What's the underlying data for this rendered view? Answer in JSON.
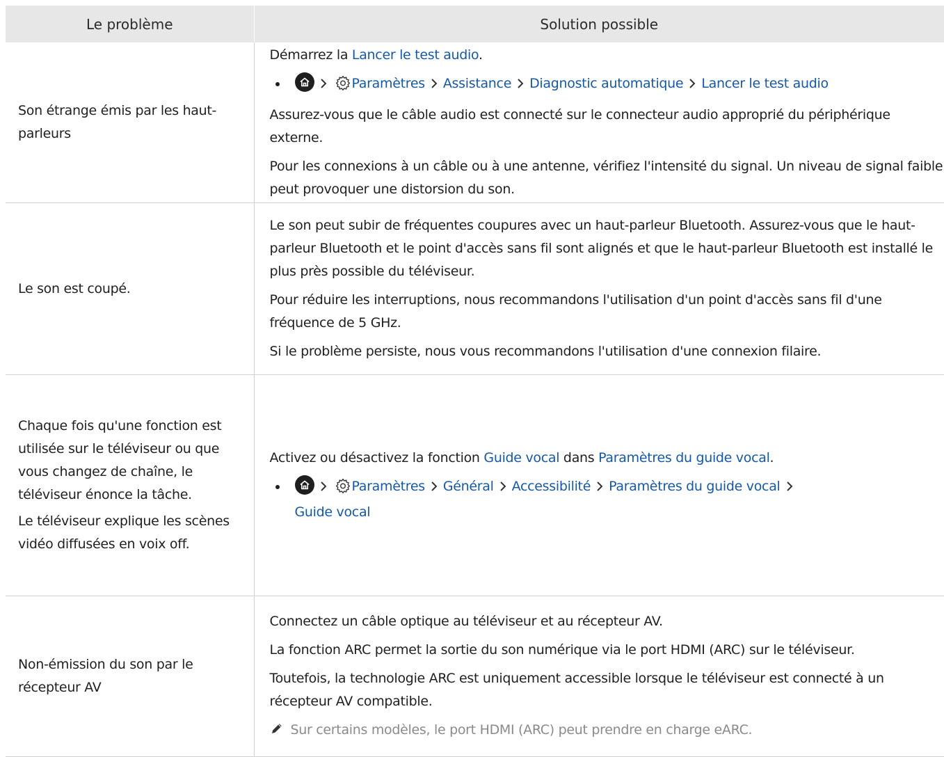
{
  "table": {
    "headers": [
      "Le problème",
      "Solution possible"
    ],
    "rows": [
      {
        "problem": [
          "Son étrange émis par les haut-parleurs"
        ],
        "intro": {
          "text": "Démarrez la ",
          "link": "Lancer le test audio",
          "end": "."
        },
        "path": [
          "Paramètres",
          "Assistance",
          "Diagnostic automatique",
          "Lancer le test audio"
        ],
        "paragraphs": [
          "Assurez-vous que le câble audio est connecté sur le connecteur audio approprié du périphérique externe.",
          "Pour les connexions à un câble ou à une antenne, vérifiez l'intensité du signal. Un niveau de signal faible peut provoquer une distorsion du son."
        ]
      },
      {
        "problem": [
          "Le son est coupé."
        ],
        "paragraphs": [
          "Le son peut subir de fréquentes coupures avec un haut-parleur Bluetooth. Assurez-vous que le haut-parleur Bluetooth et le point d'accès sans fil sont alignés et que le haut-parleur Bluetooth est installé le plus près possible du téléviseur.",
          "Pour réduire les interruptions, nous recommandons l'utilisation d'un point d'accès sans fil d'une fréquence de 5 GHz.",
          "Si le problème persiste, nous vous recommandons l'utilisation d'une connexion filaire."
        ]
      },
      {
        "problem": [
          "Chaque fois qu'une fonction est utilisée sur le téléviseur ou que vous changez de chaîne, le téléviseur énonce la tâche.",
          "Le téléviseur explique les scènes vidéo diffusées en voix off."
        ],
        "intro": {
          "text": "Activez ou désactivez la fonction ",
          "link": "Guide vocal",
          "mid": " dans ",
          "link2": "Paramètres du guide vocal",
          "end": "."
        },
        "path": [
          "Paramètres",
          "Général",
          "Accessibilité",
          "Paramètres du guide vocal",
          "Guide vocal"
        ]
      },
      {
        "problem": [
          "Non-émission du son par le récepteur AV"
        ],
        "paragraphs": [
          "Connectez un câble optique au téléviseur et au récepteur AV.",
          "La fonction ARC permet la sortie du son numérique via le port HDMI (ARC) sur le téléviseur.",
          "Toutefois, la technologie ARC est uniquement accessible lorsque le téléviseur est connecté à un récepteur AV compatible."
        ],
        "note": "Sur certains modèles, le port HDMI (ARC) peut prendre en charge eARC."
      }
    ]
  },
  "colors": {
    "link": "#1459a8",
    "header_bg": "#e7e7e7",
    "note": "#8a8a8a"
  }
}
